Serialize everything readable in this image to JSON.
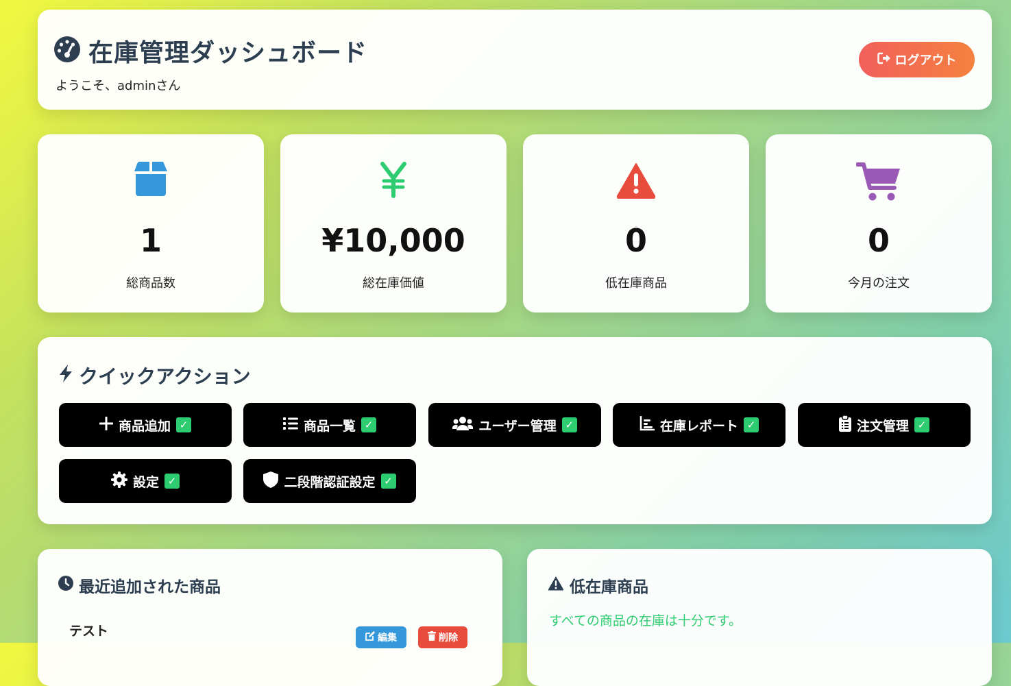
{
  "header": {
    "title": "在庫管理ダッシュボード",
    "welcome": "ようこそ、adminさん",
    "logout_label": "ログアウト"
  },
  "stats": [
    {
      "icon": "box-icon",
      "color": "#3498db",
      "value": "1",
      "label": "総商品数"
    },
    {
      "icon": "yen-icon",
      "color": "#2ecc71",
      "value": "¥10,000",
      "label": "総在庫価値"
    },
    {
      "icon": "warning-icon",
      "color": "#e74c3c",
      "value": "0",
      "label": "低在庫商品"
    },
    {
      "icon": "cart-icon",
      "color": "#9b59b6",
      "value": "0",
      "label": "今月の注文"
    }
  ],
  "quick_actions": {
    "title": "クイックアクション",
    "check_mark": "✓",
    "buttons": [
      {
        "icon": "plus-icon",
        "label": "商品追加"
      },
      {
        "icon": "list-icon",
        "label": "商品一覧"
      },
      {
        "icon": "users-icon",
        "label": "ユーザー管理"
      },
      {
        "icon": "chart-icon",
        "label": "在庫レポート"
      },
      {
        "icon": "clipboard-icon",
        "label": "注文管理"
      },
      {
        "icon": "gear-icon",
        "label": "設定"
      },
      {
        "icon": "shield-icon",
        "label": "二段階認証設定"
      }
    ]
  },
  "recent": {
    "title": "最近追加された商品",
    "items": [
      {
        "name": "テスト",
        "edit_label": "編集",
        "delete_label": "削除"
      }
    ]
  },
  "low_stock": {
    "title": "低在庫商品",
    "message": "すべての商品の在庫は十分です。"
  },
  "colors": {
    "accent_text": "#2c3e50",
    "logout_gradient": [
      "#f25f5c",
      "#f4823f"
    ],
    "success": "#2ecc71",
    "edit": "#3498db",
    "delete": "#e74c3c"
  }
}
